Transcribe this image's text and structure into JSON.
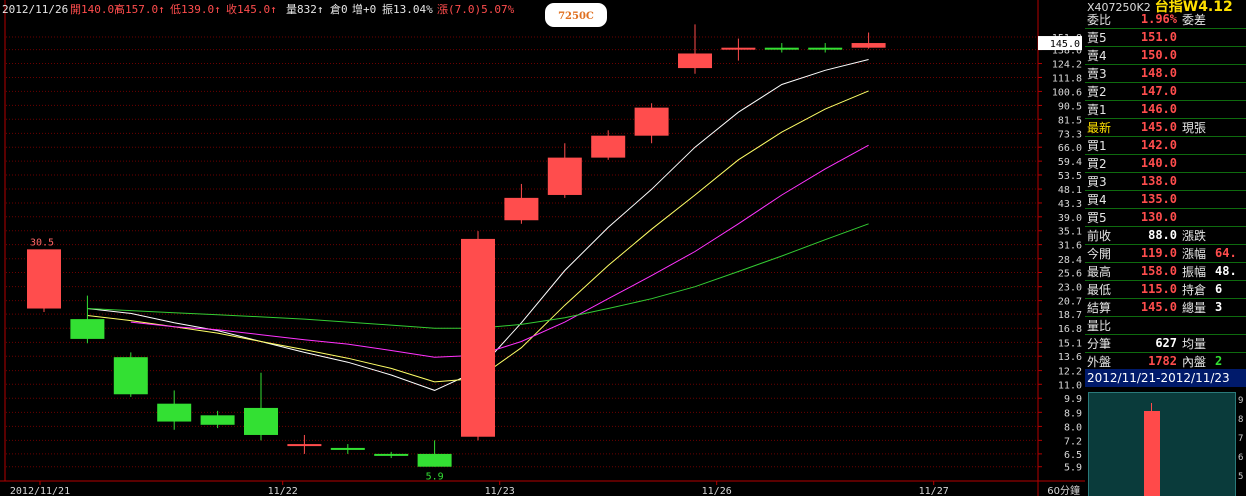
{
  "header": {
    "date": "2012/11/26",
    "open": "開140.0↑",
    "high": "高157.0↑",
    "low": "低139.0↑",
    "close": "收145.0↑",
    "volume": "量832↑",
    "oi": "倉0",
    "increase": "增+0",
    "amplitude": "振13.04%",
    "change": "漲(7.0)5.07%",
    "badge": "7250C"
  },
  "colors": {
    "up": "#ff4d4d",
    "down": "#33e033",
    "ma1": "#ffffff",
    "ma2": "#ffff66",
    "ma3": "#ff33ff",
    "ma4": "#33cc33",
    "grid": "#6b0000",
    "axis": "#b30000"
  },
  "chart_data": {
    "type": "candlestick",
    "period_label": "60分鐘",
    "x_ticks": [
      "2012/11/21",
      "11/22",
      "11/23",
      "11/26",
      "11/27"
    ],
    "y_ticks": [
      "151.8",
      "138.0",
      "124.2",
      "111.8",
      "100.6",
      "90.5",
      "81.5",
      "73.3",
      "66.0",
      "59.4",
      "53.5",
      "48.1",
      "43.3",
      "39.0",
      "35.1",
      "31.6",
      "28.4",
      "25.6",
      "23.0",
      "20.7",
      "18.7",
      "16.8",
      "15.1",
      "13.6",
      "12.2",
      "11.0",
      "9.9",
      "8.9",
      "8.0",
      "7.2",
      "6.5",
      "5.9"
    ],
    "log_scale": true,
    "ylim": [
      5.5,
      170
    ],
    "last_price_label": "145.0",
    "max_label": "30.5",
    "min_label": "5.9",
    "candles": [
      {
        "o": 19.5,
        "h": 30.5,
        "l": 19.0,
        "c": 30.5
      },
      {
        "o": 18.0,
        "h": 21.5,
        "l": 15.0,
        "c": 15.5
      },
      {
        "o": 13.5,
        "h": 14.0,
        "l": 10.0,
        "c": 10.2
      },
      {
        "o": 9.5,
        "h": 10.5,
        "l": 7.8,
        "c": 8.3
      },
      {
        "o": 8.7,
        "h": 9.0,
        "l": 7.9,
        "c": 8.1
      },
      {
        "o": 9.2,
        "h": 12.0,
        "l": 7.2,
        "c": 7.5
      },
      {
        "o": 7.0,
        "h": 7.5,
        "l": 6.5,
        "c": 7.0
      },
      {
        "o": 6.8,
        "h": 7.0,
        "l": 6.5,
        "c": 6.7
      },
      {
        "o": 6.5,
        "h": 6.6,
        "l": 6.3,
        "c": 6.45
      },
      {
        "o": 6.5,
        "h": 7.2,
        "l": 5.9,
        "c": 5.9
      },
      {
        "o": 7.4,
        "h": 35.0,
        "l": 7.2,
        "c": 33.0
      },
      {
        "o": 38.0,
        "h": 50.0,
        "l": 37.0,
        "c": 45.0
      },
      {
        "o": 46.0,
        "h": 68.0,
        "l": 45.0,
        "c": 61.0
      },
      {
        "o": 61.0,
        "h": 75.0,
        "l": 60.0,
        "c": 72.0
      },
      {
        "o": 72.0,
        "h": 92.0,
        "l": 68.0,
        "c": 89.0
      },
      {
        "o": 120.0,
        "h": 167.0,
        "l": 115.0,
        "c": 134.0
      },
      {
        "o": 140.0,
        "h": 150.0,
        "l": 127.0,
        "c": 140.0
      },
      {
        "o": 140.0,
        "h": 145.0,
        "l": 135.0,
        "c": 139.0
      },
      {
        "o": 140.0,
        "h": 145.0,
        "l": 135.0,
        "c": 139.0
      },
      {
        "o": 140.0,
        "h": 157.0,
        "l": 139.0,
        "c": 145.0
      }
    ],
    "moving_averages": [
      {
        "color": "#ffffff",
        "values": [
          null,
          19.5,
          18.8,
          17.5,
          16.5,
          15.2,
          14.0,
          13.0,
          11.8,
          10.5,
          12.2,
          17.5,
          26.0,
          36.0,
          48.0,
          66.0,
          86.0,
          106.0,
          118.0,
          128.0
        ]
      },
      {
        "color": "#ffff66",
        "values": [
          null,
          18.5,
          17.8,
          17.0,
          16.2,
          15.2,
          14.3,
          13.4,
          12.4,
          11.2,
          11.5,
          14.5,
          20.0,
          27.0,
          35.5,
          46.0,
          60.0,
          74.0,
          88.0,
          101.0
        ]
      },
      {
        "color": "#ff33ff",
        "values": [
          null,
          null,
          17.6,
          17.0,
          16.6,
          16.0,
          15.4,
          14.9,
          14.2,
          13.5,
          13.7,
          15.2,
          17.6,
          21.0,
          25.0,
          30.0,
          37.0,
          46.0,
          56.0,
          67.0
        ]
      },
      {
        "color": "#33cc33",
        "values": [
          null,
          19.5,
          19.2,
          18.9,
          18.6,
          18.3,
          18.0,
          17.6,
          17.2,
          16.8,
          16.8,
          17.3,
          18.2,
          19.5,
          21.0,
          23.0,
          25.8,
          29.0,
          32.8,
          37.0
        ]
      }
    ]
  },
  "panel": {
    "title_prefix": "X407250K2",
    "title_name": "台指W4.12",
    "rows": [
      {
        "l1": "委比",
        "v1": "1.96%",
        "c1": "#ff4d4d",
        "l2": "委差",
        "v2": "",
        "c2": "#ffffff"
      },
      {
        "l1": "賣5",
        "v1": "151.0",
        "c1": "#ff4d4d",
        "l2": "",
        "v2": "",
        "c2": "#ffffff"
      },
      {
        "l1": "賣4",
        "v1": "150.0",
        "c1": "#ff4d4d",
        "l2": "",
        "v2": "",
        "c2": "#ffffff"
      },
      {
        "l1": "賣3",
        "v1": "148.0",
        "c1": "#ff4d4d",
        "l2": "",
        "v2": "",
        "c2": "#ffffff"
      },
      {
        "l1": "賣2",
        "v1": "147.0",
        "c1": "#ff4d4d",
        "l2": "",
        "v2": "",
        "c2": "#ffffff"
      },
      {
        "l1": "賣1",
        "v1": "146.0",
        "c1": "#ff4d4d",
        "l2": "",
        "v2": "",
        "c2": "#ffffff"
      },
      {
        "l1": "最新",
        "v1": "145.0",
        "c1": "#ff4d4d",
        "l2": "現張",
        "v2": "",
        "c2": "#ffffff",
        "hl": true
      },
      {
        "l1": "買1",
        "v1": "142.0",
        "c1": "#ff4d4d",
        "l2": "",
        "v2": "",
        "c2": "#ffffff"
      },
      {
        "l1": "買2",
        "v1": "140.0",
        "c1": "#ff4d4d",
        "l2": "",
        "v2": "",
        "c2": "#ffffff"
      },
      {
        "l1": "買3",
        "v1": "138.0",
        "c1": "#ff4d4d",
        "l2": "",
        "v2": "",
        "c2": "#ffffff"
      },
      {
        "l1": "買4",
        "v1": "135.0",
        "c1": "#ff4d4d",
        "l2": "",
        "v2": "",
        "c2": "#ffffff"
      },
      {
        "l1": "買5",
        "v1": "130.0",
        "c1": "#ff4d4d",
        "l2": "",
        "v2": "",
        "c2": "#ffffff"
      },
      {
        "l1": "前收",
        "v1": "88.0",
        "c1": "#ffffff",
        "l2": "漲跌",
        "v2": "",
        "c2": "#ffffff"
      },
      {
        "l1": "今開",
        "v1": "119.0",
        "c1": "#ff4d4d",
        "l2": "漲幅",
        "v2": "64.",
        "c2": "#ff4d4d"
      },
      {
        "l1": "最高",
        "v1": "158.0",
        "c1": "#ff4d4d",
        "l2": "振幅",
        "v2": "48.",
        "c2": "#ffffff"
      },
      {
        "l1": "最低",
        "v1": "115.0",
        "c1": "#ff4d4d",
        "l2": "持倉",
        "v2": "6",
        "c2": "#ffffff"
      },
      {
        "l1": "結算",
        "v1": "145.0",
        "c1": "#ff4d4d",
        "l2": "總量",
        "v2": "3",
        "c2": "#ffffff"
      },
      {
        "l1": "量比",
        "v1": "",
        "c1": "#ffffff",
        "l2": "",
        "v2": "",
        "c2": "#ffffff"
      },
      {
        "l1": "分筆",
        "v1": "627",
        "c1": "#ffffff",
        "l2": "均量",
        "v2": "",
        "c2": "#ffffff"
      },
      {
        "l1": "外盤",
        "v1": "1782",
        "c1": "#ff4d4d",
        "l2": "內盤",
        "v2": "2",
        "c2": "#33e033"
      }
    ],
    "date_range": "2012/11/21-2012/11/23",
    "mini_scale": [
      "9",
      "8",
      "7",
      "6",
      "5"
    ]
  }
}
